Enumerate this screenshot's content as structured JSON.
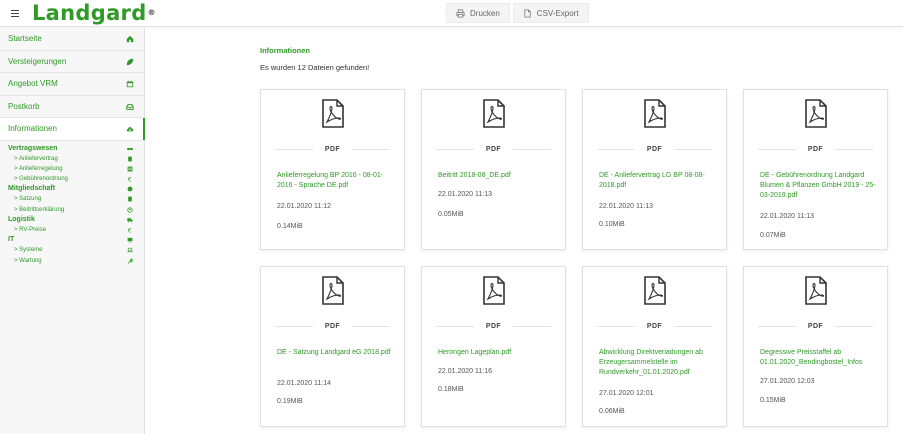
{
  "header": {
    "logo": "Landgard",
    "logo_reg": "®",
    "print_label": "Drucken",
    "csv_label": "CSV-Export"
  },
  "sidebar": {
    "items": [
      {
        "label": "Startseite",
        "icon": "home-icon"
      },
      {
        "label": "Versteigerungen",
        "icon": "leaf-icon"
      },
      {
        "label": "Angebot VRM",
        "icon": "calendar-icon"
      },
      {
        "label": "Postkorb",
        "icon": "inbox-icon"
      },
      {
        "label": "Informationen",
        "icon": "cloud-download-icon",
        "active": true
      }
    ],
    "groups": [
      {
        "title": "Vertragswesen",
        "icon": "handshake-icon",
        "links": [
          {
            "label": "> Anliefervertrag",
            "icon": "document-icon"
          },
          {
            "label": "> Anlieferregelung",
            "icon": "table-icon"
          },
          {
            "label": "> Gebührenordnung",
            "icon": "euro-icon"
          }
        ]
      },
      {
        "title": "Mitgliedschaft",
        "icon": "badge-icon",
        "links": [
          {
            "label": "> Satzung",
            "icon": "document-icon"
          },
          {
            "label": "> Beitrittserklärung",
            "icon": "user-icon"
          }
        ]
      },
      {
        "title": "Logistik",
        "icon": "truck-icon",
        "links": [
          {
            "label": "> RV-Preise",
            "icon": "euro-icon"
          }
        ]
      },
      {
        "title": "IT",
        "icon": "monitor-icon",
        "links": [
          {
            "label": "> Systeme",
            "icon": "laptop-icon"
          },
          {
            "label": "> Wartung",
            "icon": "wrench-icon"
          }
        ]
      }
    ]
  },
  "main": {
    "heading": "Informationen",
    "found_text": "Es wurden 12 Dateien gefunden!",
    "type_label": "PDF",
    "files": [
      {
        "name": "Anlieferregelung BP 2016 - 08-01-2016 - Sprache DE.pdf",
        "date": "22.01.2020 11:12",
        "size": "0.14MiB"
      },
      {
        "name": "Beitritt 2018-08_DE.pdf",
        "date": "22.01.2020 11:13",
        "size": "0.05MiB"
      },
      {
        "name": "DE - Anliefervertrag LG BP 08-08-2018.pdf",
        "date": "22.01.2020 11:13",
        "size": "0.10MiB"
      },
      {
        "name": "DE - Gebührenordnung Landgard Blumen & Pflanzen GmbH 2019 - 25-03-2019.pdf",
        "date": "22.01.2020 11:13",
        "size": "0.07MiB"
      },
      {
        "name": "DE - Satzung Landgard eG 2018.pdf",
        "date": "22.01.2020 11:14",
        "size": "0.19MiB"
      },
      {
        "name": "Herongen Lageplan.pdf",
        "date": "22.01.2020 11:16",
        "size": "0.18MiB"
      },
      {
        "name": "Abwicklung Direktveriadungen ab Erzeugersammelstelle im Rundverkehr_01.01.2020.pdf",
        "date": "27.01.2020 12:01",
        "size": "0.06MiB"
      },
      {
        "name": "Degressive Preisstaffel ab 01.01.2020_Bendingbostel_Infos",
        "date": "27.01.2020 12:03",
        "size": "0.15MiB"
      }
    ]
  },
  "colors": {
    "brand_green": "#2f9a27"
  }
}
